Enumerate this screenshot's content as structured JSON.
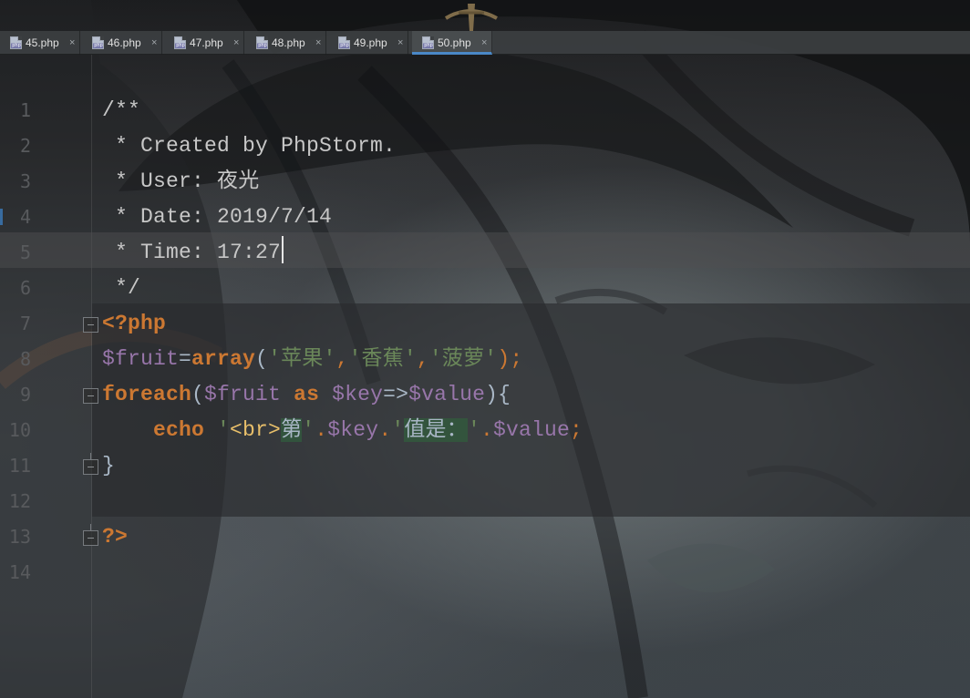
{
  "tabs": [
    {
      "label": "45.php",
      "close": "×",
      "icon": "php-file-icon"
    },
    {
      "label": "46.php",
      "close": "×",
      "icon": "php-file-icon"
    },
    {
      "label": "47.php",
      "close": "×",
      "icon": "php-file-icon"
    },
    {
      "label": "48.php",
      "close": "×",
      "icon": "php-file-icon"
    },
    {
      "label": "49.php",
      "close": "×",
      "icon": "php-file-icon"
    },
    {
      "label": "50.php",
      "close": "×",
      "icon": "php-file-icon",
      "active": true
    }
  ],
  "editor": {
    "lines": [
      {
        "number": "1"
      },
      {
        "number": "2",
        "text": "/**"
      },
      {
        "number": "3",
        "text": " * Created by PhpStorm."
      },
      {
        "number": "4",
        "text": " * User: 夜光"
      },
      {
        "number": "5",
        "text": " * Date: 2019/7/14"
      },
      {
        "number": "6",
        "text": " * Time: 17:27"
      },
      {
        "number": "7",
        "text": " */"
      },
      {
        "number": "8",
        "text": "<?php"
      },
      {
        "number": "9",
        "parts": [
          "$fruit",
          "=",
          "array",
          "(",
          "'苹果'",
          ",",
          "'香蕉'",
          ",",
          "'菠萝'",
          ");"
        ]
      },
      {
        "number": "10",
        "parts": [
          "foreach",
          "(",
          "$fruit",
          " as ",
          "$key",
          "=>",
          "$value",
          "){"
        ]
      },
      {
        "number": "11",
        "parts": [
          "    echo ",
          "'",
          "<br>",
          "第",
          "'",
          ".",
          "$key",
          ".",
          "'",
          "值是：",
          "'",
          ".",
          "$value",
          ";"
        ]
      },
      {
        "number": "12",
        "text": "}"
      },
      {
        "number": "13"
      },
      {
        "number": "14",
        "text": "?>"
      }
    ]
  },
  "colors": {
    "keyword": "#cc7832",
    "variable": "#9876aa",
    "string": "#6a8759",
    "html_tag": "#e8bf6a",
    "comment": "#c7c7c7",
    "active_tab": "#4a88c7"
  }
}
